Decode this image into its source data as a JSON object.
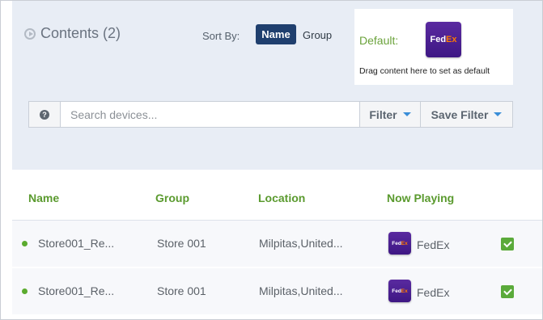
{
  "header": {
    "contents_title": "Contents (2)",
    "sort_by_label": "Sort By:",
    "sort_options": [
      {
        "label": "Name",
        "active": true
      },
      {
        "label": "Group",
        "active": false
      }
    ]
  },
  "default_content": {
    "label": "Default:",
    "logo_text_fed": "Fed",
    "logo_text_ex": "Ex",
    "hint": "Drag content here to set as default"
  },
  "search": {
    "help_icon": "?",
    "placeholder": "Search devices...",
    "filter_label": "Filter",
    "save_filter_label": "Save Filter"
  },
  "table": {
    "columns": [
      "Name",
      "Group",
      "Location",
      "Now Playing"
    ],
    "rows": [
      {
        "name": "Store001_Re...",
        "group": "Store 001",
        "location": "Milpitas,United...",
        "now_playing": "FedEx",
        "logo_fed": "Fed",
        "logo_ex": "Ex",
        "status": "online",
        "checked": true
      },
      {
        "name": "Store001_Re...",
        "group": "Store 001",
        "location": "Milpitas,United...",
        "now_playing": "FedEx",
        "logo_fed": "Fed",
        "logo_ex": "Ex",
        "status": "online",
        "checked": true
      }
    ]
  },
  "colors": {
    "accent_green": "#5a9a2e",
    "sort_active_bg": "#1f3f6e",
    "logo_purple": "#4d2190",
    "logo_orange": "#ff7a00"
  }
}
